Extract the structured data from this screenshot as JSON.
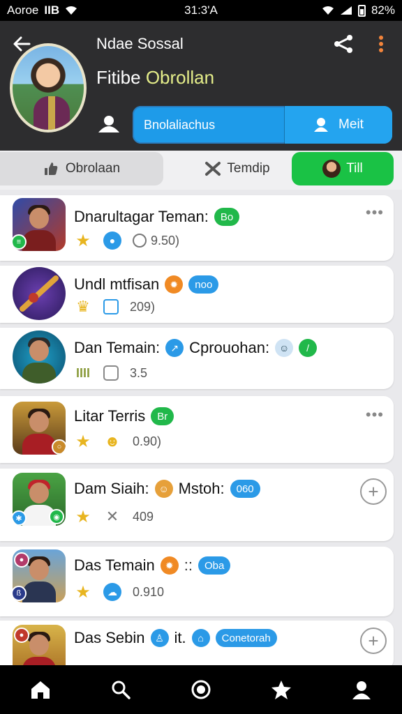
{
  "status_bar": {
    "left": "Aoroe",
    "carrier": "IIB",
    "time": "31:3'A",
    "battery": "82%"
  },
  "header": {
    "title": "Ndae Sossal",
    "subtitle_a": "Fitibe ",
    "subtitle_b": "Obrollan",
    "split_left": "Bnolaliachus",
    "split_right": "Meit"
  },
  "tabs": [
    {
      "label": "Obrolaan"
    },
    {
      "label": "Temdip"
    },
    {
      "label": "Till"
    }
  ],
  "items": [
    {
      "title": "Dnarultagar Teman:",
      "tag": "Bo",
      "count": "9.50)"
    },
    {
      "title": "Undl mtfisan",
      "tag": "noo",
      "count": "209)"
    },
    {
      "title": "Dan Temain:",
      "title2": "Cprouohan:",
      "count": "3.5"
    },
    {
      "title": "Litar Terris",
      "tag": "Br",
      "count": "0.90)"
    },
    {
      "title": "Dam Siaih:",
      "title2": "Mstoh:",
      "tag": "060",
      "count": "409"
    },
    {
      "title": "Das Temain",
      "tag": "Oba",
      "count": "0.910"
    },
    {
      "title": "Das Sebin",
      "title2": "it.",
      "tag": "Conetorah",
      "count": ""
    }
  ],
  "nav": [
    "home-icon",
    "search-icon",
    "record-icon",
    "star-icon",
    "profile-icon"
  ],
  "colors": {
    "accent_blue": "#1e9be9",
    "accent_green": "#1ac245",
    "header_bg": "#2d2d2f"
  }
}
